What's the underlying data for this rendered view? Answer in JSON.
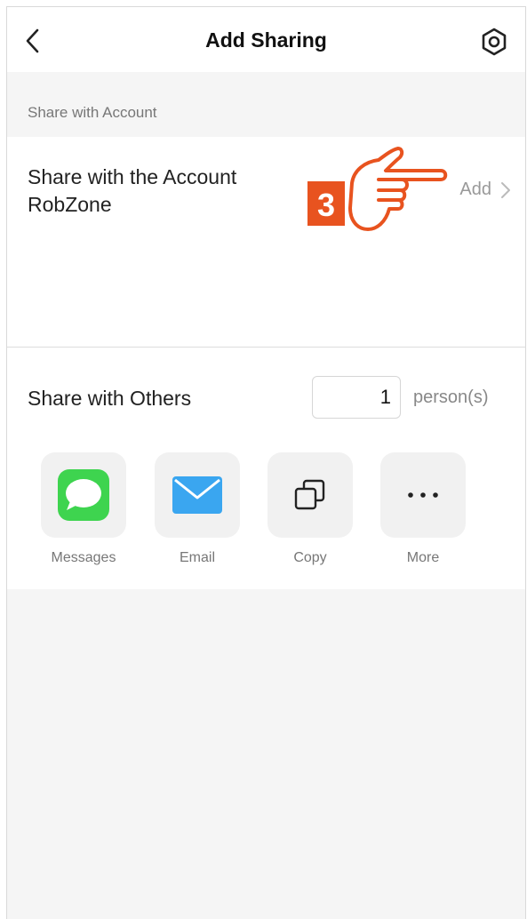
{
  "nav": {
    "title": "Add Sharing"
  },
  "section": {
    "share_with_account_header": "Share with Account"
  },
  "account": {
    "share_label": "Share with the Account RobZone",
    "add_label": "Add"
  },
  "annotation": {
    "step_number": "3",
    "color": "#e8531f"
  },
  "others": {
    "label": "Share with Others",
    "quantity": "1",
    "unit": "person(s)"
  },
  "share_options": [
    {
      "label": "Messages",
      "icon": "messages-icon",
      "color": "#3ed44f"
    },
    {
      "label": "Email",
      "icon": "email-icon",
      "color": "#3aa6f0"
    },
    {
      "label": "Copy",
      "icon": "copy-icon",
      "color": "#222222"
    },
    {
      "label": "More",
      "icon": "more-icon",
      "color": "#222222"
    }
  ]
}
